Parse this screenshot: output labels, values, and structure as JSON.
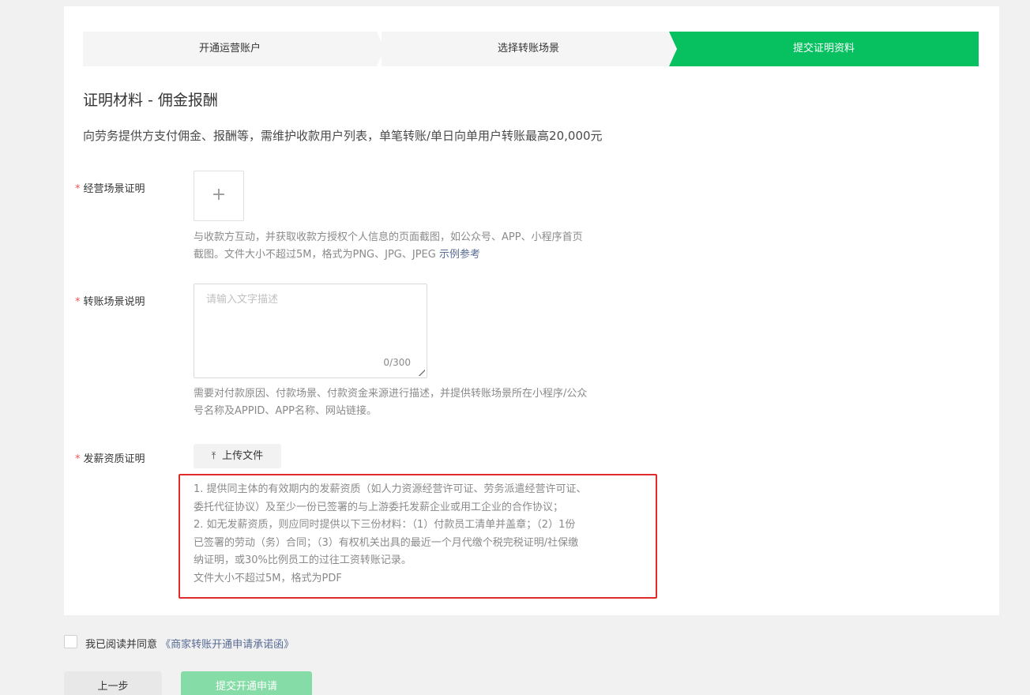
{
  "steps": [
    {
      "label": "开通运营账户"
    },
    {
      "label": "选择转账场景"
    },
    {
      "label": "提交证明资料"
    }
  ],
  "title": "证明材料 - 佣金报酬",
  "description": "向劳务提供方支付佣金、报酬等，需维护收款用户列表，单笔转账/单日向单用户转账最高20,000元",
  "required_mark": "*",
  "field1": {
    "label": "经营场景证明",
    "upload_icon": "plus-icon",
    "hint_line1": "与收款方互动，并获取收款方授权个人信息的页面截图，如公众号、APP、小程序首页",
    "hint_line2": "截图。文件大小不超过5M，格式为PNG、JPG、JPEG",
    "example_link": "示例参考"
  },
  "field2": {
    "label": "转账场景说明",
    "placeholder": "请输入文字描述",
    "counter": "0/300",
    "hint_line1": "需要对付款原因、付款场景、付款资金来源进行描述，并提供转账场景所在小程序/公众",
    "hint_line2": "号名称及APPID、APP名称、网站链接。"
  },
  "field3": {
    "label": "发薪资质证明",
    "upload_label": "上传文件",
    "upload_icon": "upload-icon",
    "notes": [
      "1. 提供同主体的有效期内的发薪资质（如人力资源经营许可证、劳务派遣经营许可证、",
      "委托代征协议）及至少一份已签署的与上游委托发薪企业或用工企业的合作协议；",
      "2. 如无发薪资质，则应同时提供以下三份材料：（1）付款员工清单并盖章；（2）1份",
      "已签署的劳动（务）合同；（3）有权机关出具的最近一个月代缴个税完税证明/社保缴",
      "纳证明，或30%比例员工的过往工资转账记录。",
      "文件大小不超过5M，格式为PDF"
    ]
  },
  "agreement": {
    "text": "我已阅读并同意",
    "link": "《商家转账开通申请承诺函》"
  },
  "buttons": {
    "prev": "上一步",
    "submit": "提交开通申请"
  },
  "colors": {
    "accent": "#07c160",
    "accent_disabled": "#85dca6",
    "link": "#576b95",
    "required": "#fa5151",
    "highlight_border": "#e12b2b"
  }
}
